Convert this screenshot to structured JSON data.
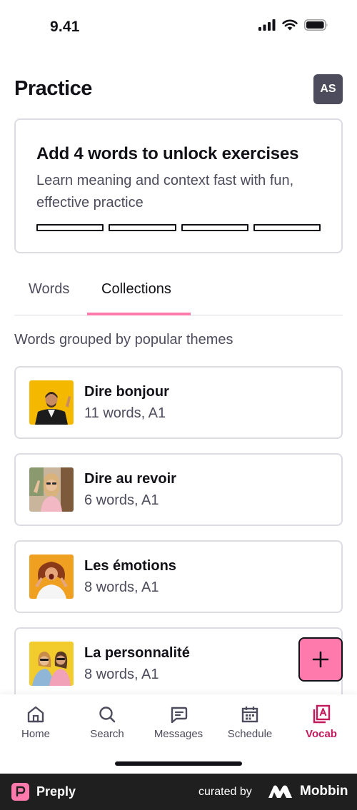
{
  "status_bar": {
    "time": "9.41"
  },
  "header": {
    "title": "Practice",
    "avatar_initials": "AS"
  },
  "unlock_card": {
    "title": "Add 4 words to unlock exercises",
    "subtitle_line1": "Learn meaning and context fast with fun,",
    "subtitle_line2": "effective practice",
    "progress_total": 4,
    "progress_filled": 0
  },
  "tabs": [
    {
      "label": "Words",
      "selected": false
    },
    {
      "label": "Collections",
      "selected": true
    }
  ],
  "section_subtitle": "Words grouped by popular themes",
  "collections": [
    {
      "title": "Dire bonjour",
      "meta": "11 words, A1"
    },
    {
      "title": "Dire au revoir",
      "meta": "6 words, A1"
    },
    {
      "title": "Les émotions",
      "meta": "8 words, A1"
    },
    {
      "title": "La personnalité",
      "meta": "8 words, A1"
    }
  ],
  "fab": {
    "icon": "plus-icon"
  },
  "bottom_nav": [
    {
      "label": "Home",
      "icon": "home-icon"
    },
    {
      "label": "Search",
      "icon": "search-icon"
    },
    {
      "label": "Messages",
      "icon": "messages-icon"
    },
    {
      "label": "Schedule",
      "icon": "calendar-icon"
    },
    {
      "label": "Vocab",
      "icon": "vocab-icon",
      "active": true
    }
  ],
  "footer": {
    "brand": "Preply",
    "curated_by": "curated by",
    "curator": "Mobbin"
  },
  "colors": {
    "accent_pink": "#ff7aac",
    "active_nav": "#c5195d",
    "text": "#121117",
    "muted": "#4d4c5c",
    "border": "#dcdce5"
  }
}
